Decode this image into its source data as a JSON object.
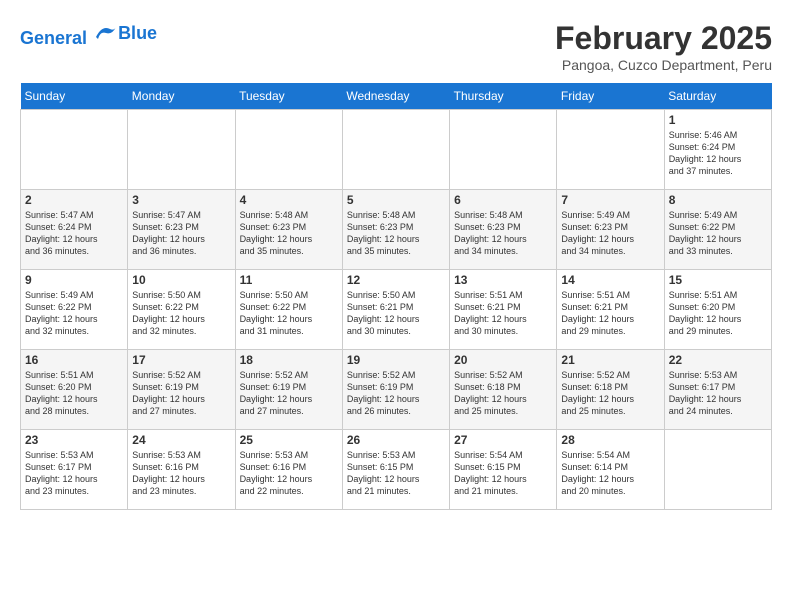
{
  "logo": {
    "line1": "General",
    "line2": "Blue"
  },
  "title": "February 2025",
  "subtitle": "Pangoa, Cuzco Department, Peru",
  "days_of_week": [
    "Sunday",
    "Monday",
    "Tuesday",
    "Wednesday",
    "Thursday",
    "Friday",
    "Saturday"
  ],
  "weeks": [
    [
      {
        "day": "",
        "info": ""
      },
      {
        "day": "",
        "info": ""
      },
      {
        "day": "",
        "info": ""
      },
      {
        "day": "",
        "info": ""
      },
      {
        "day": "",
        "info": ""
      },
      {
        "day": "",
        "info": ""
      },
      {
        "day": "1",
        "info": "Sunrise: 5:46 AM\nSunset: 6:24 PM\nDaylight: 12 hours\nand 37 minutes."
      }
    ],
    [
      {
        "day": "2",
        "info": "Sunrise: 5:47 AM\nSunset: 6:24 PM\nDaylight: 12 hours\nand 36 minutes."
      },
      {
        "day": "3",
        "info": "Sunrise: 5:47 AM\nSunset: 6:23 PM\nDaylight: 12 hours\nand 36 minutes."
      },
      {
        "day": "4",
        "info": "Sunrise: 5:48 AM\nSunset: 6:23 PM\nDaylight: 12 hours\nand 35 minutes."
      },
      {
        "day": "5",
        "info": "Sunrise: 5:48 AM\nSunset: 6:23 PM\nDaylight: 12 hours\nand 35 minutes."
      },
      {
        "day": "6",
        "info": "Sunrise: 5:48 AM\nSunset: 6:23 PM\nDaylight: 12 hours\nand 34 minutes."
      },
      {
        "day": "7",
        "info": "Sunrise: 5:49 AM\nSunset: 6:23 PM\nDaylight: 12 hours\nand 34 minutes."
      },
      {
        "day": "8",
        "info": "Sunrise: 5:49 AM\nSunset: 6:22 PM\nDaylight: 12 hours\nand 33 minutes."
      }
    ],
    [
      {
        "day": "9",
        "info": "Sunrise: 5:49 AM\nSunset: 6:22 PM\nDaylight: 12 hours\nand 32 minutes."
      },
      {
        "day": "10",
        "info": "Sunrise: 5:50 AM\nSunset: 6:22 PM\nDaylight: 12 hours\nand 32 minutes."
      },
      {
        "day": "11",
        "info": "Sunrise: 5:50 AM\nSunset: 6:22 PM\nDaylight: 12 hours\nand 31 minutes."
      },
      {
        "day": "12",
        "info": "Sunrise: 5:50 AM\nSunset: 6:21 PM\nDaylight: 12 hours\nand 30 minutes."
      },
      {
        "day": "13",
        "info": "Sunrise: 5:51 AM\nSunset: 6:21 PM\nDaylight: 12 hours\nand 30 minutes."
      },
      {
        "day": "14",
        "info": "Sunrise: 5:51 AM\nSunset: 6:21 PM\nDaylight: 12 hours\nand 29 minutes."
      },
      {
        "day": "15",
        "info": "Sunrise: 5:51 AM\nSunset: 6:20 PM\nDaylight: 12 hours\nand 29 minutes."
      }
    ],
    [
      {
        "day": "16",
        "info": "Sunrise: 5:51 AM\nSunset: 6:20 PM\nDaylight: 12 hours\nand 28 minutes."
      },
      {
        "day": "17",
        "info": "Sunrise: 5:52 AM\nSunset: 6:19 PM\nDaylight: 12 hours\nand 27 minutes."
      },
      {
        "day": "18",
        "info": "Sunrise: 5:52 AM\nSunset: 6:19 PM\nDaylight: 12 hours\nand 27 minutes."
      },
      {
        "day": "19",
        "info": "Sunrise: 5:52 AM\nSunset: 6:19 PM\nDaylight: 12 hours\nand 26 minutes."
      },
      {
        "day": "20",
        "info": "Sunrise: 5:52 AM\nSunset: 6:18 PM\nDaylight: 12 hours\nand 25 minutes."
      },
      {
        "day": "21",
        "info": "Sunrise: 5:52 AM\nSunset: 6:18 PM\nDaylight: 12 hours\nand 25 minutes."
      },
      {
        "day": "22",
        "info": "Sunrise: 5:53 AM\nSunset: 6:17 PM\nDaylight: 12 hours\nand 24 minutes."
      }
    ],
    [
      {
        "day": "23",
        "info": "Sunrise: 5:53 AM\nSunset: 6:17 PM\nDaylight: 12 hours\nand 23 minutes."
      },
      {
        "day": "24",
        "info": "Sunrise: 5:53 AM\nSunset: 6:16 PM\nDaylight: 12 hours\nand 23 minutes."
      },
      {
        "day": "25",
        "info": "Sunrise: 5:53 AM\nSunset: 6:16 PM\nDaylight: 12 hours\nand 22 minutes."
      },
      {
        "day": "26",
        "info": "Sunrise: 5:53 AM\nSunset: 6:15 PM\nDaylight: 12 hours\nand 21 minutes."
      },
      {
        "day": "27",
        "info": "Sunrise: 5:54 AM\nSunset: 6:15 PM\nDaylight: 12 hours\nand 21 minutes."
      },
      {
        "day": "28",
        "info": "Sunrise: 5:54 AM\nSunset: 6:14 PM\nDaylight: 12 hours\nand 20 minutes."
      },
      {
        "day": "",
        "info": ""
      }
    ]
  ]
}
